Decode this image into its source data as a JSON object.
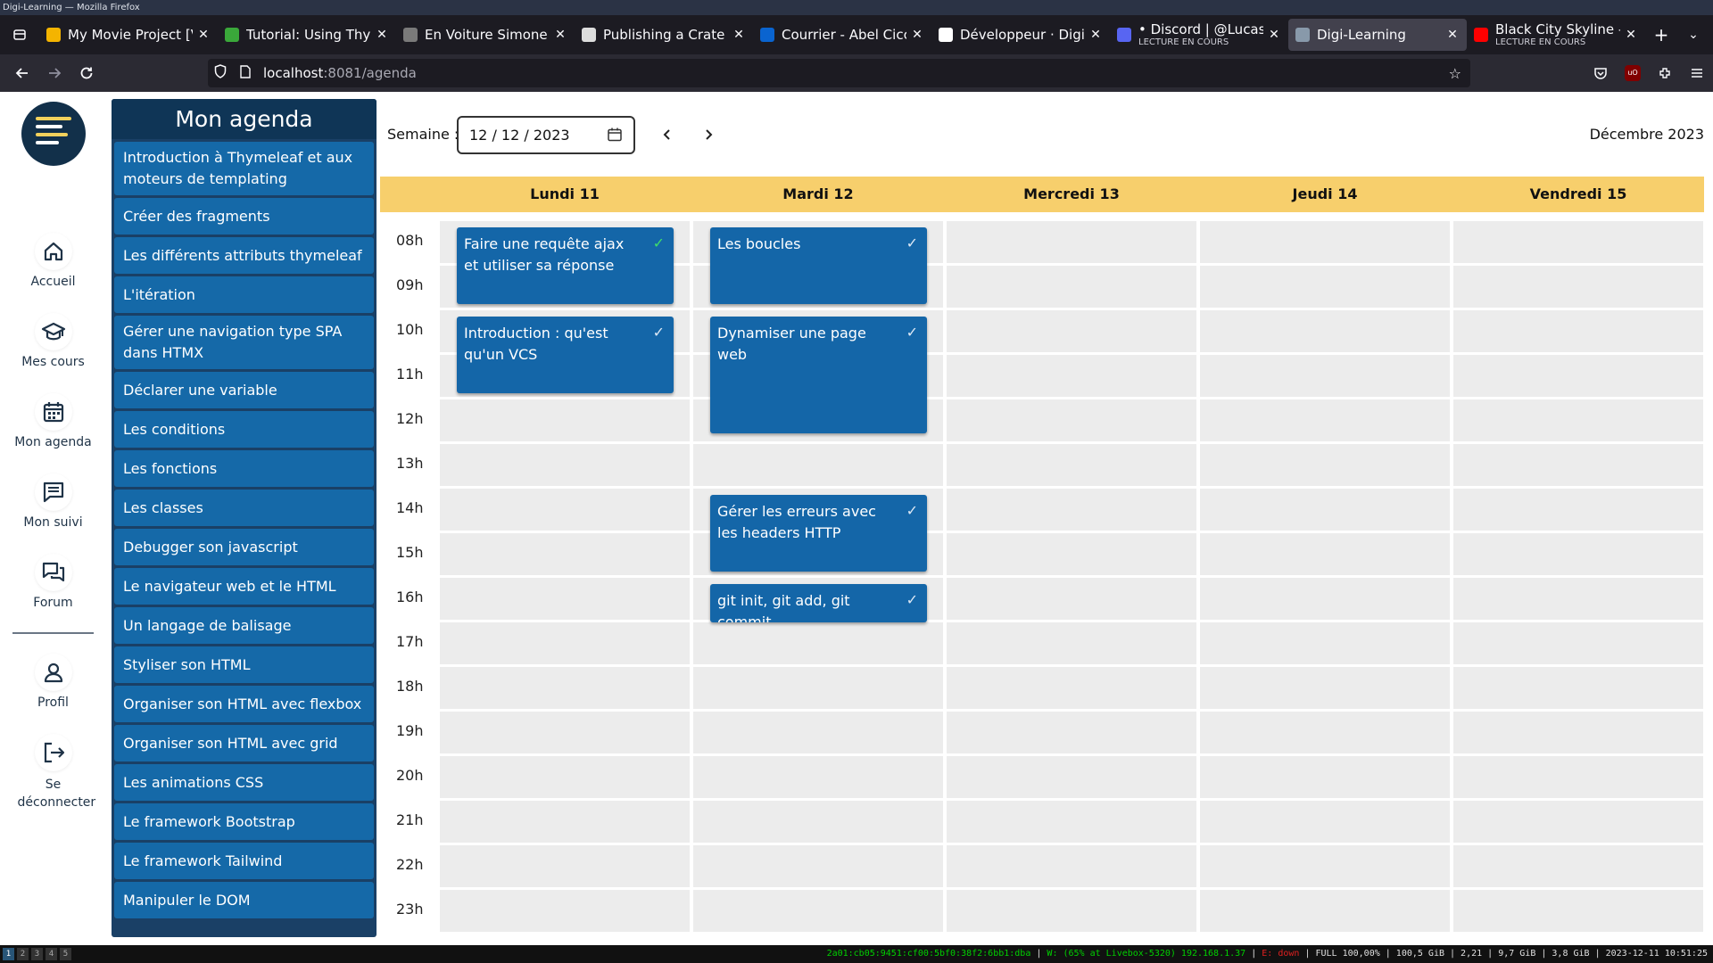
{
  "window": {
    "title": "Digi-Learning — Mozilla Firefox"
  },
  "tabs": [
    {
      "label": "My Movie Project [VC",
      "icon": "google-drive-icon",
      "color": "#f4b400"
    },
    {
      "label": "Tutorial: Using Thyme",
      "icon": "check-icon",
      "color": "#3aa83a"
    },
    {
      "label": "En Voiture Simone",
      "icon": "car-icon",
      "color": "#7a7a7a"
    },
    {
      "label": "Publishing a Crate to",
      "icon": "book-icon",
      "color": "#dddddd"
    },
    {
      "label": "Courrier - Abel Ciccol",
      "icon": "outlook-icon",
      "color": "#0a64d0"
    },
    {
      "label": "Développeur · DigiSu",
      "icon": "github-icon",
      "color": "#ffffff"
    },
    {
      "label": "• Discord | @Lucas",
      "sub": "LECTURE EN COURS",
      "icon": "discord-icon",
      "color": "#5865f2"
    },
    {
      "label": "Digi-Learning",
      "icon": "digi-icon",
      "color": "#8899aa",
      "active": true
    },
    {
      "label": "Black City Skyline - Y",
      "sub": "LECTURE EN COURS",
      "icon": "youtube-icon",
      "color": "#ff0000"
    }
  ],
  "url": {
    "host": "localhost",
    "path": ":8081/agenda"
  },
  "rail": {
    "items": [
      {
        "label": "Accueil",
        "icon": "home-icon"
      },
      {
        "label": "Mes cours",
        "icon": "graduation-cap-icon"
      },
      {
        "label": "Mon agenda",
        "icon": "calendar-icon"
      },
      {
        "label": "Mon suivi",
        "icon": "message-icon"
      },
      {
        "label": "Forum",
        "icon": "forum-icon"
      }
    ],
    "bottom": [
      {
        "label": "Profil",
        "icon": "user-icon"
      },
      {
        "label": "Se déconnecter",
        "icon": "logout-icon"
      }
    ]
  },
  "courses": {
    "title": "Mon agenda",
    "items": [
      "Introduction à Thymeleaf et aux moteurs de templating",
      "Créer des fragments",
      "Les différents attributs thymeleaf",
      "L'itération",
      "Gérer une navigation type SPA dans HTMX",
      "Déclarer une variable",
      "Les conditions",
      "Les fonctions",
      "Les classes",
      "Debugger son javascript",
      "Le navigateur web et le HTML",
      "Un langage de balisage",
      "Styliser son HTML",
      "Organiser son HTML avec flexbox",
      "Organiser son HTML avec grid",
      "Les animations CSS",
      "Le framework Bootstrap",
      "Le framework Tailwind",
      "Manipuler le DOM"
    ]
  },
  "agenda": {
    "week_label": "Semaine :",
    "week_value": "12 / 12 / 2023",
    "month": "Décembre 2023",
    "days": [
      "Lundi 11",
      "Mardi 12",
      "Mercredi 13",
      "Jeudi 14",
      "Vendredi 15"
    ],
    "hours": [
      "08h",
      "09h",
      "10h",
      "11h",
      "12h",
      "13h",
      "14h",
      "15h",
      "16h",
      "17h",
      "18h",
      "19h",
      "20h",
      "21h",
      "22h",
      "23h"
    ],
    "events": [
      {
        "day": 0,
        "start": 8,
        "duration": 1.75,
        "title": "Faire une requête ajax et utiliser sa réponse",
        "done": true,
        "check_color": "green"
      },
      {
        "day": 0,
        "start": 10,
        "duration": 1.75,
        "title": "Introduction : qu'est qu'un VCS",
        "done": true,
        "check_color": "white"
      },
      {
        "day": 1,
        "start": 8,
        "duration": 1.75,
        "title": "Les boucles",
        "done": true,
        "check_color": "white"
      },
      {
        "day": 1,
        "start": 10,
        "duration": 2.65,
        "title": "Dynamiser une page web",
        "done": true,
        "check_color": "white"
      },
      {
        "day": 1,
        "start": 14,
        "duration": 1.75,
        "title": "Gérer les erreurs avec les headers HTTP",
        "done": true,
        "check_color": "white"
      },
      {
        "day": 1,
        "start": 16,
        "duration": 0.9,
        "title": "git init, git add, git commit",
        "done": true,
        "check_color": "white"
      }
    ]
  },
  "statusbar": {
    "workspaces": [
      "1",
      "2",
      "3",
      "4",
      "5"
    ],
    "ipv6": "2a01:cb05:9451:cf00:5bf0:38f2:6bb1:dba",
    "wifi": "W: (65% at Livebox-5320) 192.168.1.37",
    "eth": "E: down",
    "rest": "FULL 100,00% | 100,5 GiB | 2,21 | 9,7 GiB | 3,8 GiB | 2023-12-11 10:51:25"
  }
}
